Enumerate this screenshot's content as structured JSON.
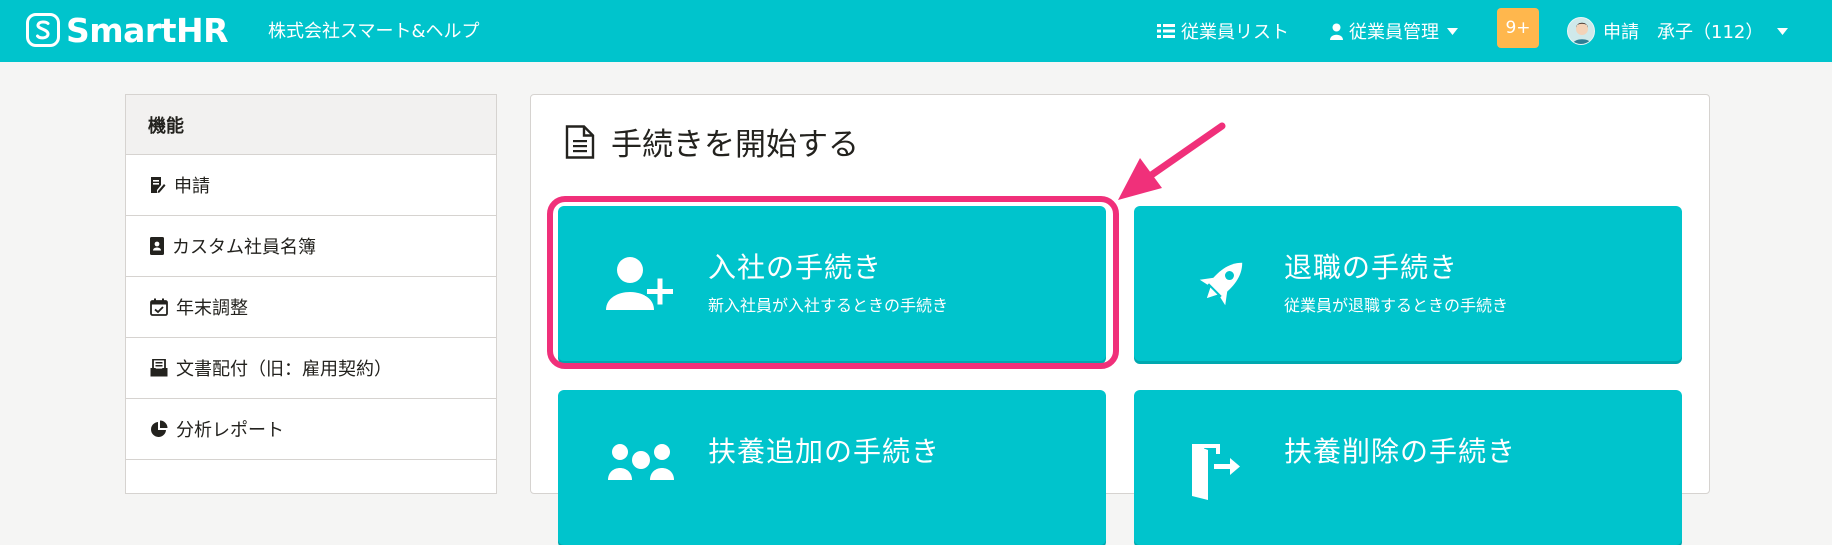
{
  "header": {
    "brand": "SmartHR",
    "company": "株式会社スマート&ヘルプ",
    "nav_employee_list": "従業員リスト",
    "nav_employee_manage": "従業員管理",
    "notifications": "9+",
    "user_name": "申請　承子（112）",
    "icons": {
      "list": "list-icon",
      "user": "user-icon",
      "caret": "caret-down-icon"
    }
  },
  "sidebar": {
    "heading": "機能",
    "items": [
      {
        "label": "申請",
        "icon": "request-icon"
      },
      {
        "label": "カスタム社員名簿",
        "icon": "contact-book-icon"
      },
      {
        "label": "年末調整",
        "icon": "calendar-check-icon"
      },
      {
        "label": "文書配付（旧：雇用契約）",
        "icon": "document-box-icon"
      },
      {
        "label": "分析レポート",
        "icon": "pie-chart-icon"
      }
    ]
  },
  "main": {
    "title": "手続きを開始する",
    "title_icon": "document-icon",
    "cards": [
      {
        "title": "入社の手続き",
        "subtitle": "新入社員が入社するときの手続き",
        "icon": "user-plus-icon"
      },
      {
        "title": "退職の手続き",
        "subtitle": "従業員が退職するときの手続き",
        "icon": "rocket-icon"
      },
      {
        "title": "扶養追加の手続き",
        "subtitle": "",
        "icon": "users-icon"
      },
      {
        "title": "扶養削除の手続き",
        "subtitle": "",
        "icon": "exit-door-icon"
      }
    ]
  },
  "colors": {
    "brand": "#00c4cc",
    "badge": "#ffb74d",
    "highlight": "#f0307a"
  }
}
